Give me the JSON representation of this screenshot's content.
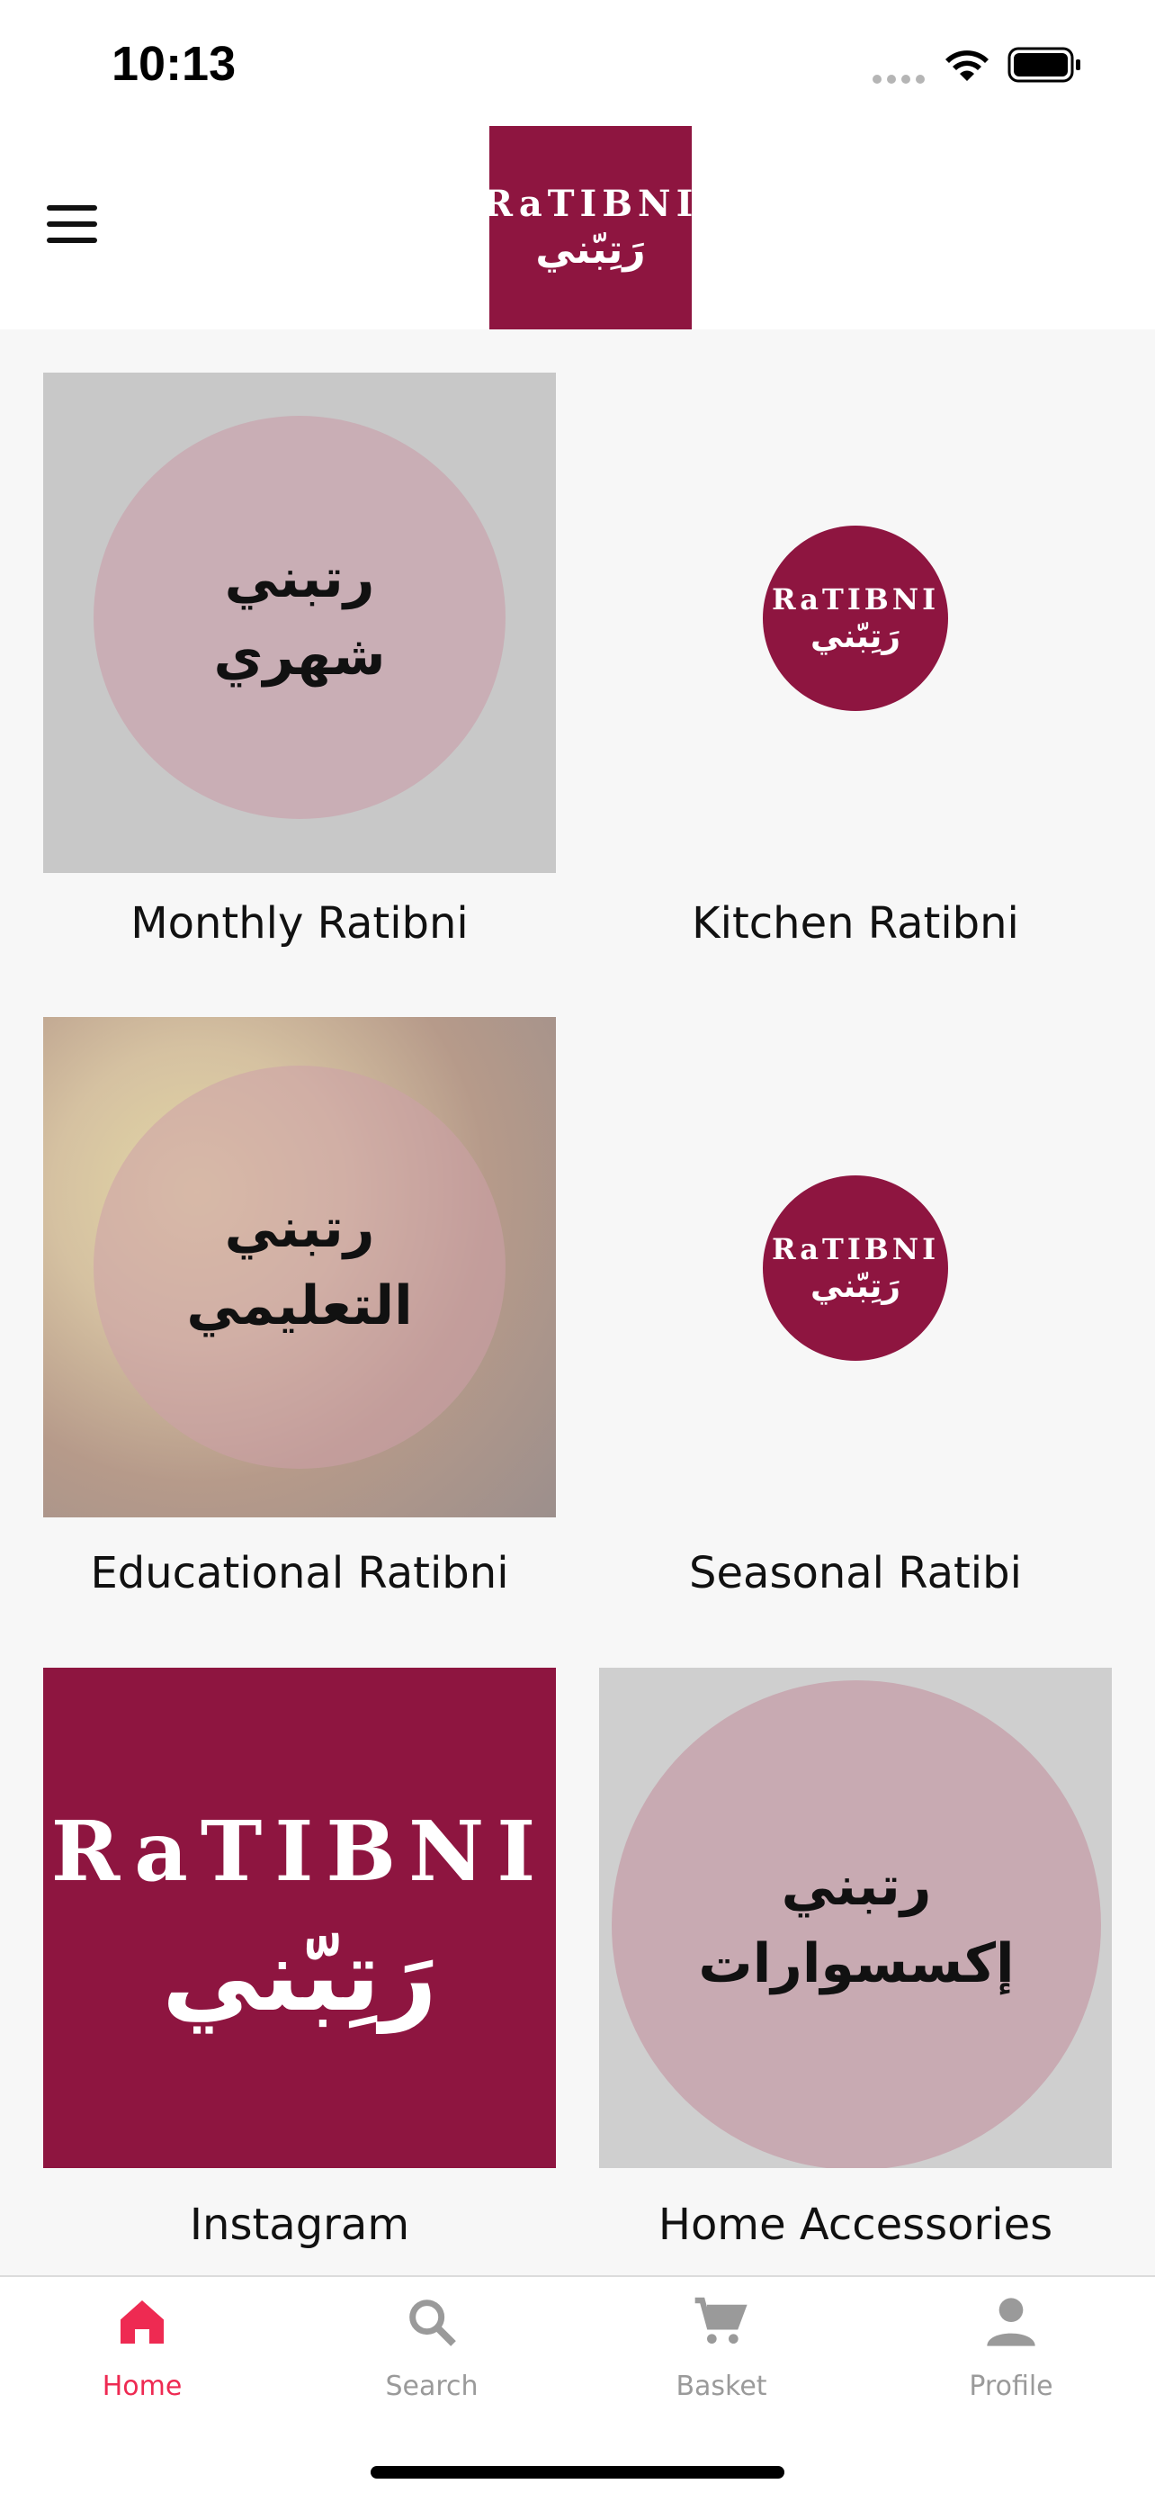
{
  "status_bar": {
    "time": "10:13"
  },
  "header": {
    "menu_icon": "hamburger-menu-icon",
    "logo_text_latin": "RaTIBNI",
    "logo_text_arabic": "رَتِبّني"
  },
  "cards": [
    {
      "label": "Monthly Ratibni",
      "image_text": [
        "رتبني",
        "شهري"
      ]
    },
    {
      "label": "Kitchen Ratibni",
      "image_text": []
    },
    {
      "label": "Educational Ratibni",
      "image_text": [
        "رتبني",
        "التعليمي"
      ]
    },
    {
      "label": "Seasonal Ratibi",
      "image_text": []
    },
    {
      "label": "Instagram",
      "image_text": []
    },
    {
      "label": "Home Accessories",
      "image_text": [
        "رتبني",
        "إكسسوارات"
      ]
    }
  ],
  "tabs": [
    {
      "label": "Home",
      "icon": "home-icon",
      "active": true
    },
    {
      "label": "Search",
      "icon": "search-icon",
      "active": false
    },
    {
      "label": "Basket",
      "icon": "cart-icon",
      "active": false
    },
    {
      "label": "Profile",
      "icon": "person-icon",
      "active": false
    }
  ],
  "colors": {
    "brand": "#8e1540",
    "accent": "#ee2a52",
    "tab_inactive": "#9a9a9a"
  }
}
